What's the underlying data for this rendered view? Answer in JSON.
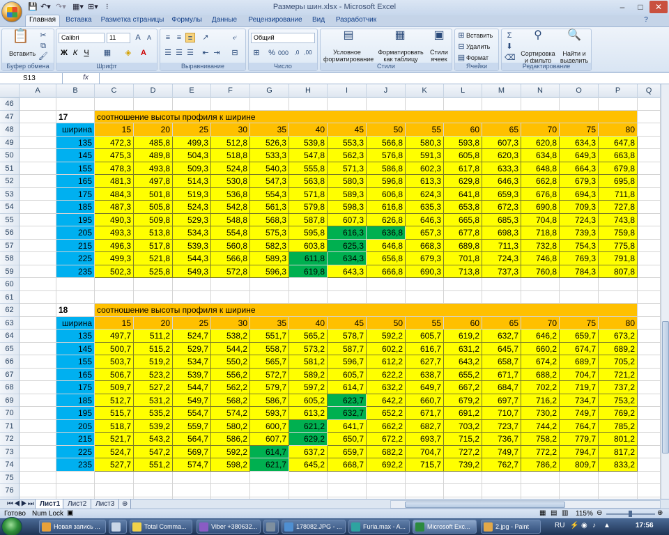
{
  "window": {
    "title": "Размеры шин.xlsx - Microsoft Excel",
    "controls": [
      "–",
      "□",
      "✕"
    ]
  },
  "ribbon": {
    "tabs": [
      "Главная",
      "Вставка",
      "Разметка страницы",
      "Формулы",
      "Данные",
      "Рецензирование",
      "Вид",
      "Разработчик"
    ],
    "active_tab": "Главная",
    "groups": {
      "clipboard": {
        "label": "Буфер обмена",
        "paste": "Вставить"
      },
      "font": {
        "label": "Шрифт",
        "font_name": "Calibri",
        "font_size": "11"
      },
      "alignment": {
        "label": "Выравнивание"
      },
      "number": {
        "label": "Число",
        "format": "Общий"
      },
      "styles": {
        "label": "Стили",
        "conditional": "Условное форматирование",
        "as_table": "Форматировать как таблицу",
        "cell_styles": "Стили ячеек"
      },
      "cells": {
        "label": "Ячейки",
        "insert": "Вставить",
        "delete": "Удалить",
        "format": "Формат"
      },
      "editing": {
        "label": "Редактирование",
        "sort": "Сортировка и фильтр",
        "find": "Найти и выделить"
      }
    }
  },
  "formula_bar": {
    "name_box": "S13",
    "fx": "fx",
    "formula": ""
  },
  "columns": [
    "A",
    "B",
    "C",
    "D",
    "E",
    "F",
    "G",
    "H",
    "I",
    "J",
    "K",
    "L",
    "M",
    "N",
    "O",
    "P",
    "Q"
  ],
  "blocks": [
    {
      "title_row": 47,
      "diameter": "17",
      "header": "соотношение высоты профиля к ширине",
      "width_label": "ширина",
      "ratios": [
        "15",
        "20",
        "25",
        "30",
        "35",
        "40",
        "45",
        "50",
        "55",
        "60",
        "65",
        "70",
        "75",
        "80"
      ],
      "rows": [
        {
          "r": 49,
          "w": "135",
          "v": [
            "472,3",
            "485,8",
            "499,3",
            "512,8",
            "526,3",
            "539,8",
            "553,3",
            "566,8",
            "580,3",
            "593,8",
            "607,3",
            "620,8",
            "634,3",
            "647,8"
          ]
        },
        {
          "r": 50,
          "w": "145",
          "v": [
            "475,3",
            "489,8",
            "504,3",
            "518,8",
            "533,3",
            "547,8",
            "562,3",
            "576,8",
            "591,3",
            "605,8",
            "620,3",
            "634,8",
            "649,3",
            "663,8"
          ]
        },
        {
          "r": 51,
          "w": "155",
          "v": [
            "478,3",
            "493,8",
            "509,3",
            "524,8",
            "540,3",
            "555,8",
            "571,3",
            "586,8",
            "602,3",
            "617,8",
            "633,3",
            "648,8",
            "664,3",
            "679,8"
          ]
        },
        {
          "r": 52,
          "w": "165",
          "v": [
            "481,3",
            "497,8",
            "514,3",
            "530,8",
            "547,3",
            "563,8",
            "580,3",
            "596,8",
            "613,3",
            "629,8",
            "646,3",
            "662,8",
            "679,3",
            "695,8"
          ]
        },
        {
          "r": 53,
          "w": "175",
          "v": [
            "484,3",
            "501,8",
            "519,3",
            "536,8",
            "554,3",
            "571,8",
            "589,3",
            "606,8",
            "624,3",
            "641,8",
            "659,3",
            "676,8",
            "694,3",
            "711,8"
          ]
        },
        {
          "r": 54,
          "w": "185",
          "v": [
            "487,3",
            "505,8",
            "524,3",
            "542,8",
            "561,3",
            "579,8",
            "598,3",
            "616,8",
            "635,3",
            "653,8",
            "672,3",
            "690,8",
            "709,3",
            "727,8"
          ]
        },
        {
          "r": 55,
          "w": "195",
          "v": [
            "490,3",
            "509,8",
            "529,3",
            "548,8",
            "568,3",
            "587,8",
            "607,3",
            "626,8",
            "646,3",
            "665,8",
            "685,3",
            "704,8",
            "724,3",
            "743,8"
          ]
        },
        {
          "r": 56,
          "w": "205",
          "v": [
            "493,3",
            "513,8",
            "534,3",
            "554,8",
            "575,3",
            "595,8",
            "616,3",
            "636,8",
            "657,3",
            "677,8",
            "698,3",
            "718,8",
            "739,3",
            "759,8"
          ],
          "green": [
            6,
            7
          ]
        },
        {
          "r": 57,
          "w": "215",
          "v": [
            "496,3",
            "517,8",
            "539,3",
            "560,8",
            "582,3",
            "603,8",
            "625,3",
            "646,8",
            "668,3",
            "689,8",
            "711,3",
            "732,8",
            "754,3",
            "775,8"
          ],
          "green": [
            6
          ]
        },
        {
          "r": 58,
          "w": "225",
          "v": [
            "499,3",
            "521,8",
            "544,3",
            "566,8",
            "589,3",
            "611,8",
            "634,3",
            "656,8",
            "679,3",
            "701,8",
            "724,3",
            "746,8",
            "769,3",
            "791,8"
          ],
          "green": [
            5,
            6
          ]
        },
        {
          "r": 59,
          "w": "235",
          "v": [
            "502,3",
            "525,8",
            "549,3",
            "572,8",
            "596,3",
            "619,8",
            "643,3",
            "666,8",
            "690,3",
            "713,8",
            "737,3",
            "760,8",
            "784,3",
            "807,8"
          ],
          "green": [
            5
          ]
        }
      ]
    },
    {
      "title_row": 62,
      "diameter": "18",
      "header": "соотношение высоты профиля к ширине",
      "width_label": "ширина",
      "ratios": [
        "15",
        "20",
        "25",
        "30",
        "35",
        "40",
        "45",
        "50",
        "55",
        "60",
        "65",
        "70",
        "75",
        "80"
      ],
      "rows": [
        {
          "r": 64,
          "w": "135",
          "v": [
            "497,7",
            "511,2",
            "524,7",
            "538,2",
            "551,7",
            "565,2",
            "578,7",
            "592,2",
            "605,7",
            "619,2",
            "632,7",
            "646,2",
            "659,7",
            "673,2"
          ]
        },
        {
          "r": 65,
          "w": "145",
          "v": [
            "500,7",
            "515,2",
            "529,7",
            "544,2",
            "558,7",
            "573,2",
            "587,7",
            "602,2",
            "616,7",
            "631,2",
            "645,7",
            "660,2",
            "674,7",
            "689,2"
          ]
        },
        {
          "r": 66,
          "w": "155",
          "v": [
            "503,7",
            "519,2",
            "534,7",
            "550,2",
            "565,7",
            "581,2",
            "596,7",
            "612,2",
            "627,7",
            "643,2",
            "658,7",
            "674,2",
            "689,7",
            "705,2"
          ]
        },
        {
          "r": 67,
          "w": "165",
          "v": [
            "506,7",
            "523,2",
            "539,7",
            "556,2",
            "572,7",
            "589,2",
            "605,7",
            "622,2",
            "638,7",
            "655,2",
            "671,7",
            "688,2",
            "704,7",
            "721,2"
          ]
        },
        {
          "r": 68,
          "w": "175",
          "v": [
            "509,7",
            "527,2",
            "544,7",
            "562,2",
            "579,7",
            "597,2",
            "614,7",
            "632,2",
            "649,7",
            "667,2",
            "684,7",
            "702,2",
            "719,7",
            "737,2"
          ]
        },
        {
          "r": 69,
          "w": "185",
          "v": [
            "512,7",
            "531,2",
            "549,7",
            "568,2",
            "586,7",
            "605,2",
            "623,7",
            "642,2",
            "660,7",
            "679,2",
            "697,7",
            "716,2",
            "734,7",
            "753,2"
          ],
          "green": [
            6
          ]
        },
        {
          "r": 70,
          "w": "195",
          "v": [
            "515,7",
            "535,2",
            "554,7",
            "574,2",
            "593,7",
            "613,2",
            "632,7",
            "652,2",
            "671,7",
            "691,2",
            "710,7",
            "730,2",
            "749,7",
            "769,2"
          ],
          "green": [
            6
          ]
        },
        {
          "r": 71,
          "w": "205",
          "v": [
            "518,7",
            "539,2",
            "559,7",
            "580,2",
            "600,7",
            "621,2",
            "641,7",
            "662,2",
            "682,7",
            "703,2",
            "723,7",
            "744,2",
            "764,7",
            "785,2"
          ],
          "green": [
            5
          ]
        },
        {
          "r": 72,
          "w": "215",
          "v": [
            "521,7",
            "543,2",
            "564,7",
            "586,2",
            "607,7",
            "629,2",
            "650,7",
            "672,2",
            "693,7",
            "715,2",
            "736,7",
            "758,2",
            "779,7",
            "801,2"
          ],
          "green": [
            5
          ]
        },
        {
          "r": 73,
          "w": "225",
          "v": [
            "524,7",
            "547,2",
            "569,7",
            "592,2",
            "614,7",
            "637,2",
            "659,7",
            "682,2",
            "704,7",
            "727,2",
            "749,7",
            "772,2",
            "794,7",
            "817,2"
          ],
          "green": [
            4
          ]
        },
        {
          "r": 74,
          "w": "235",
          "v": [
            "527,7",
            "551,2",
            "574,7",
            "598,2",
            "621,7",
            "645,2",
            "668,7",
            "692,2",
            "715,7",
            "739,2",
            "762,7",
            "786,2",
            "809,7",
            "833,2"
          ],
          "green": [
            4
          ]
        }
      ]
    }
  ],
  "empty_rows": [
    46,
    60,
    61,
    75,
    76,
    77,
    78,
    79
  ],
  "sheets": [
    "Лист1",
    "Лист2",
    "Лист3"
  ],
  "active_sheet": "Лист1",
  "status": {
    "ready": "Готово",
    "numlock": "Num Lock",
    "zoom": "115%"
  },
  "taskbar": {
    "items": [
      {
        "label": "Новая запись ...",
        "color": "#e8a23a"
      },
      {
        "label": "",
        "color": "#c9d6e6"
      },
      {
        "label": "Total Comma...",
        "color": "#f2d34a"
      },
      {
        "label": "Viber +380632...",
        "color": "#8a5cc4"
      },
      {
        "label": "",
        "color": "#7e8f9f"
      },
      {
        "label": "178082.JPG - ...",
        "color": "#4f8fd1"
      },
      {
        "label": "Furia.max - A...",
        "color": "#2ea3a0"
      },
      {
        "label": "Microsoft Exc...",
        "color": "#2c8a3e"
      },
      {
        "label": "2.jpg - Paint",
        "color": "#e2a848"
      }
    ],
    "lang": "RU",
    "time": "17:56"
  }
}
